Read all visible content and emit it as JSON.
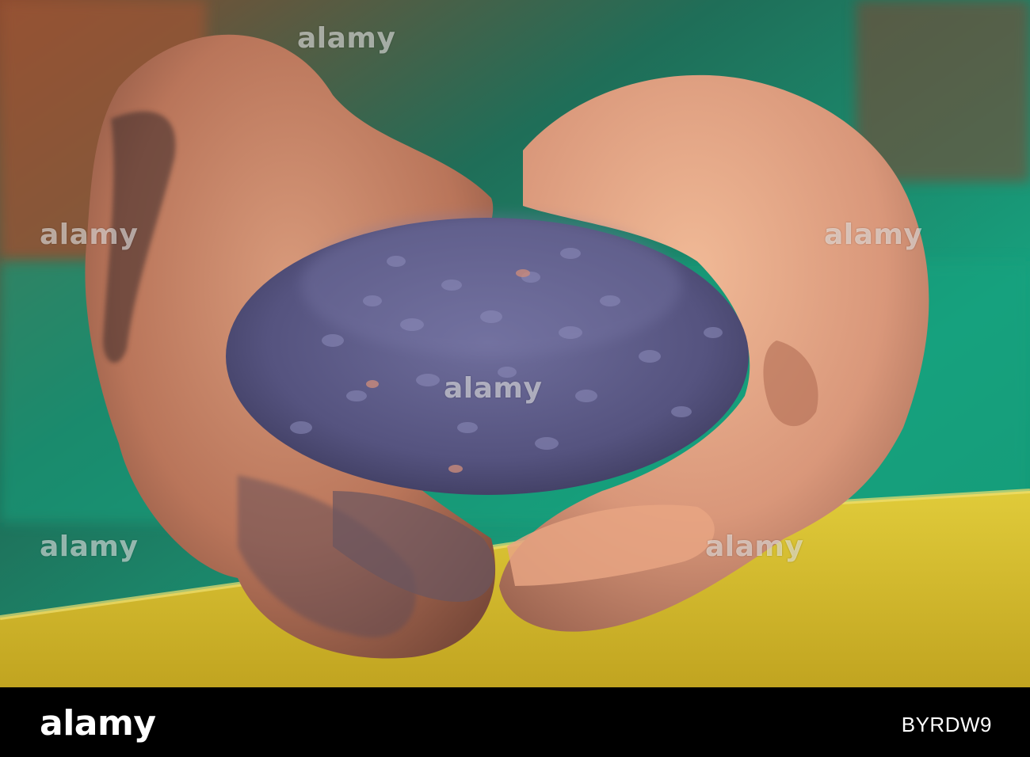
{
  "photo": {
    "subject": "cupped-hands-with-purple-coated-seeds",
    "colors": {
      "background_teal": "#1a9c7c",
      "bin_yellow": "#d6c024",
      "seed_purple": "#5c5a86",
      "skin": "#c8866a"
    }
  },
  "watermarks": [
    "alamy",
    "alamy",
    "alamy",
    "alamy",
    "alamy",
    "alamy"
  ],
  "footer": {
    "logo": "alamy",
    "image_id": "BYRDW9"
  }
}
